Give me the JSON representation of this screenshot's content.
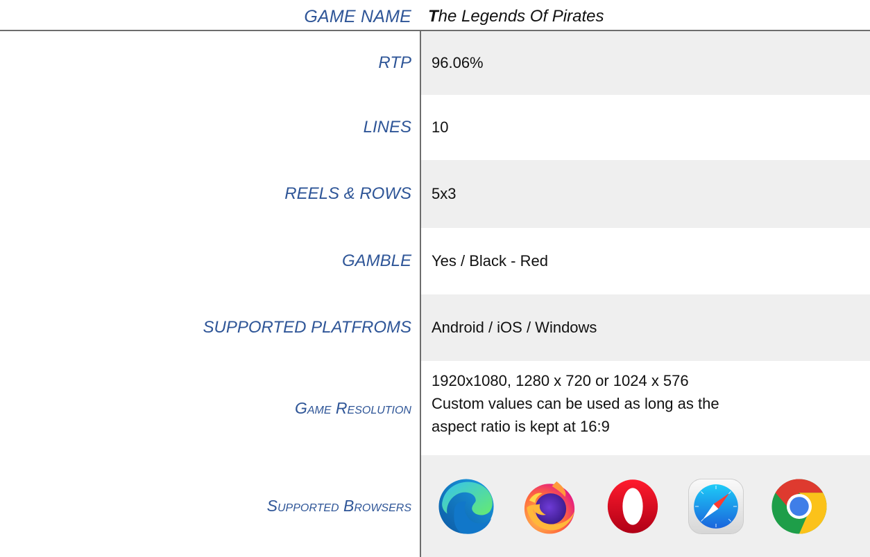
{
  "header": {
    "label": "GAME NAME",
    "value_first": "T",
    "value_rest": "he Legends Of Pirates"
  },
  "rows": [
    {
      "label": "RTP",
      "value": "96.06%"
    },
    {
      "label": "LINES",
      "value": "10"
    },
    {
      "label": "REELS & ROWS",
      "value": "5x3"
    },
    {
      "label": "GAMBLE",
      "value": "Yes / Black - Red"
    },
    {
      "label": "SUPPORTED PLATFROMS",
      "value": "Android / iOS / Windows"
    }
  ],
  "resolution": {
    "label": "Game Resolution",
    "line1": "1920x1080, 1280 x 720 or 1024 x 576",
    "line2": "Custom values can be used as long as the",
    "line3": "aspect ratio is kept at 16:9"
  },
  "browsers": {
    "label": "Supported Browsers",
    "items": [
      "edge-icon",
      "firefox-icon",
      "opera-icon",
      "safari-icon",
      "chrome-icon"
    ]
  },
  "colors": {
    "label_blue": "#2e5597",
    "shade": "#efefef",
    "rule": "#6d6d6d"
  }
}
